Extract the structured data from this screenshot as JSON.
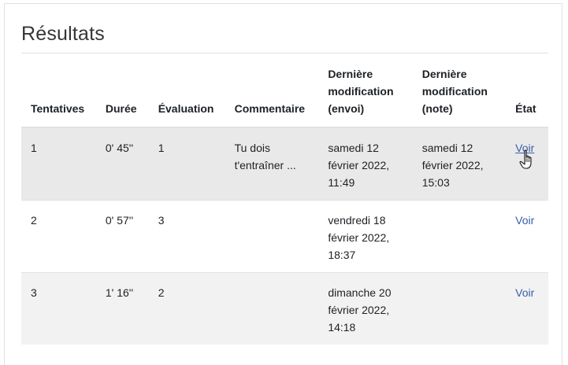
{
  "section": {
    "title": "Résultats"
  },
  "table": {
    "headers": {
      "attempts": "Tentatives",
      "duration": "Durée",
      "grade": "Évaluation",
      "comment": "Commentaire",
      "modified_submission_1": "Dernière",
      "modified_submission_2": "modification",
      "modified_submission_3": "(envoi)",
      "modified_grade_1": "Dernière",
      "modified_grade_2": "modification",
      "modified_grade_3": "(note)",
      "status": "État"
    },
    "rows": [
      {
        "attempt": "1",
        "duration": "0' 45''",
        "grade": "1",
        "comment_1": "Tu dois",
        "comment_2": "t'entraîner ...",
        "submission_1": "samedi 12",
        "submission_2": "février 2022,",
        "submission_3": "11:49",
        "graded_1": "samedi 12",
        "graded_2": "février 2022,",
        "graded_3": "15:03",
        "status_link": "Voir"
      },
      {
        "attempt": "2",
        "duration": "0' 57''",
        "grade": "3",
        "comment_1": "",
        "comment_2": "",
        "submission_1": "vendredi 18",
        "submission_2": "février 2022,",
        "submission_3": "18:37",
        "graded_1": "",
        "graded_2": "",
        "graded_3": "",
        "status_link": "Voir"
      },
      {
        "attempt": "3",
        "duration": "1' 16''",
        "grade": "2",
        "comment_1": "",
        "comment_2": "",
        "submission_1": "dimanche 20",
        "submission_2": "février 2022,",
        "submission_3": "14:18",
        "graded_1": "",
        "graded_2": "",
        "graded_3": "",
        "status_link": "Voir"
      }
    ]
  },
  "icons": {
    "cursor": "hand-pointer-cursor-icon"
  },
  "colors": {
    "link": "#3a5da8",
    "row_hover": "#e9e9e9",
    "row_shaded": "#f2f2f2",
    "border": "#dee2e6"
  }
}
